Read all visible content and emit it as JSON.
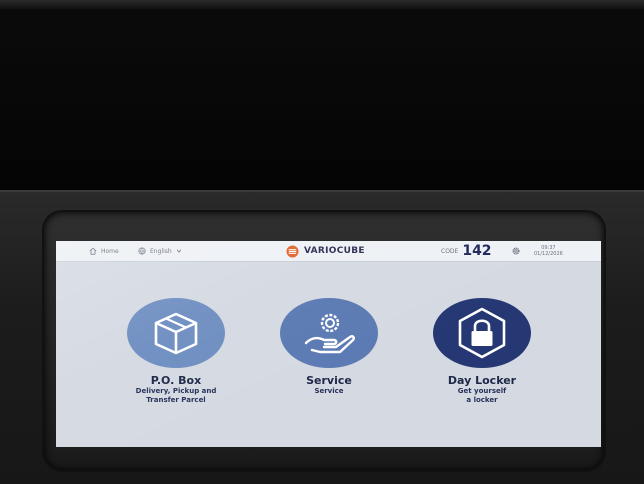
{
  "topbar": {
    "home_label": "Home",
    "language_label": "English",
    "brand": "VARIOCUBE",
    "code_label": "CODE",
    "code_value": "142",
    "time": "09:37",
    "date": "01/12/2026"
  },
  "icons": {
    "home": "home-icon",
    "language": "globe-icon",
    "language_dropdown": "chevron-down-icon",
    "brand": "variocube-logo-icon",
    "settings": "gear-icon",
    "po_box": "box-icon",
    "service": "hand-gear-icon",
    "day_locker": "lock-icon"
  },
  "tiles": [
    {
      "title": "P.O. Box",
      "subtitle_line1": "Delivery, Pickup and",
      "subtitle_line2": "Transfer Parcel"
    },
    {
      "title": "Service",
      "subtitle_line1": "Service",
      "subtitle_line2": ""
    },
    {
      "title": "Day Locker",
      "subtitle_line1": "Get yourself",
      "subtitle_line2": "a locker"
    }
  ],
  "colors": {
    "screen_bg": "#d5dae2",
    "topbar_bg": "#eef1f5",
    "po_circle": "#6e8ec1",
    "service_circle": "#5b7ab3",
    "day_locker_circle": "#253873",
    "title_text": "#1d2747"
  }
}
